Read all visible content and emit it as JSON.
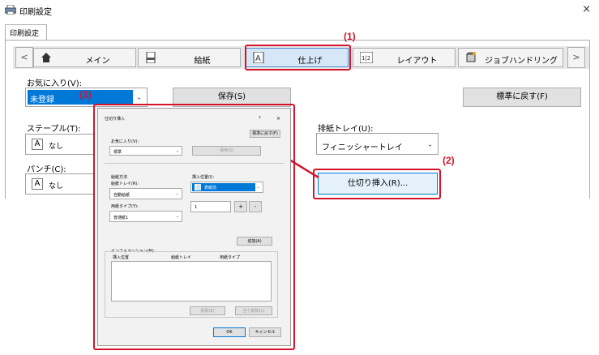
{
  "window": {
    "title": "印刷設定",
    "close": "×"
  },
  "tab_header": "印刷設定",
  "tabs": [
    {
      "label": "メイン",
      "icon": "home-icon"
    },
    {
      "label": "給紙",
      "icon": "paper-tray-icon"
    },
    {
      "label": "仕上げ",
      "icon": "finishing-icon",
      "active": true
    },
    {
      "label": "レイアウト",
      "icon": "layout-icon"
    },
    {
      "label": "ジョブハンドリング",
      "icon": "job-handling-icon"
    }
  ],
  "nav": {
    "prev": "<",
    "next": ">"
  },
  "favorites": {
    "label": "お気に入り(V):",
    "value": "未登録",
    "save": "保存(S)",
    "default": "標準に戻す(F)"
  },
  "staple": {
    "label": "ステープル(T):",
    "value": "なし"
  },
  "punch": {
    "label": "パンチ(C):",
    "value": "なし"
  },
  "output_tray": {
    "label": "排紙トレイ(U):",
    "value": "フィニッシャートレイ"
  },
  "insert_button": "仕切り挿入(R)...",
  "callouts": {
    "c1": "(1)",
    "c2": "(2)",
    "c3": "(3)"
  },
  "dialog": {
    "title": "仕切り挿入",
    "help": "?",
    "close": "×",
    "reset": "標準に戻す(F)",
    "fav_label": "お気に入り(V):",
    "fav_value": "標準",
    "save": "保存(S)",
    "feed_method": "給紙方法",
    "tray_label": "給紙トレイ(R):",
    "tray_value": "自動給紙",
    "ptype_label": "用紙タイプ(Y):",
    "ptype_value": "普通紙1",
    "pos_label": "挿入位置(I):",
    "pos_value": "表紙前",
    "page_value": "1",
    "plus": "+",
    "minus": "-",
    "add": "追加(A)",
    "info_label": "インフォメーション(N):",
    "col_pos": "挿入位置",
    "col_tray": "給紙トレイ",
    "col_type": "用紙タイプ",
    "delete": "削除(E)",
    "delete_all": "全て削除(L)",
    "ok": "OK",
    "cancel": "キャンセル"
  }
}
